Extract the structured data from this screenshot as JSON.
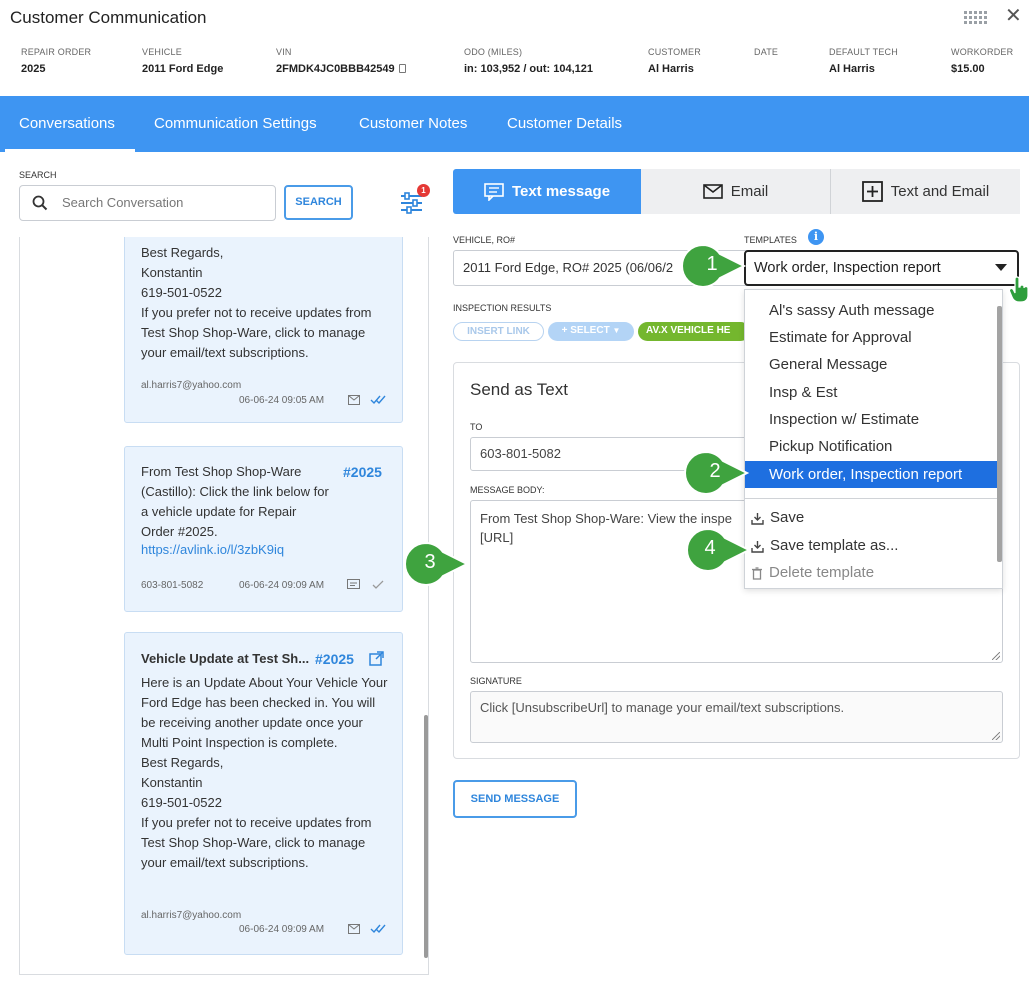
{
  "window": {
    "title": "Customer Communication",
    "close_glyph": "✕"
  },
  "info": [
    {
      "label": "REPAIR ORDER",
      "value": "2025"
    },
    {
      "label": "VEHICLE",
      "value": "2011 Ford Edge"
    },
    {
      "label": "VIN",
      "value": "2FMDK4JC0BBB42549"
    },
    {
      "label": "ODO (MILES)",
      "value": "in: 103,952 / out: 104,121"
    },
    {
      "label": "CUSTOMER",
      "value": "Al Harris"
    },
    {
      "label": "DATE",
      "value": ""
    },
    {
      "label": "DEFAULT TECH",
      "value": "Al Harris"
    },
    {
      "label": "WORKORDER",
      "value": "$15.00"
    }
  ],
  "nav": {
    "tabs": [
      {
        "label": "Conversations",
        "active": true
      },
      {
        "label": "Communication Settings"
      },
      {
        "label": "Customer Notes"
      },
      {
        "label": "Customer Details"
      }
    ],
    "accent": "#3e95f2"
  },
  "search": {
    "label": "SEARCH",
    "placeholder": "Search Conversation",
    "button": "SEARCH",
    "filter_badge": "1"
  },
  "conversations": [
    {
      "body": "Best Regards,\nKonstantin\n619-501-0522\nIf you prefer not to receive updates from Test Shop Shop-Ware, click to manage your email/text subscriptions.",
      "sender": "al.harris7@yahoo.com",
      "time": "06-06-24 09:05 AM"
    },
    {
      "body": "From Test Shop Shop-Ware (Castillo): Click the link below for a vehicle update for Repair Order #2025.",
      "link": "https://avlink.io/l/3zbK9iq",
      "ro": "#2025",
      "sender": "603-801-5082",
      "time": "06-06-24 09:09 AM"
    },
    {
      "heading": "Vehicle Update at Test Sh...",
      "ro": "#2025",
      "body": "Here is an Update About Your Vehicle Your Ford Edge has been checked in. You will be receiving another update once your Multi Point Inspection is complete.\nBest Regards,\nKonstantin\n619-501-0522\nIf you prefer not to receive updates from Test Shop Shop-Ware, click to manage your email/text subscriptions.",
      "sender": "al.harris7@yahoo.com",
      "time": "06-06-24 09:09 AM"
    }
  ],
  "channels": {
    "text": "Text message",
    "email": "Email",
    "both": "Text and Email"
  },
  "form": {
    "vehicle_label": "VEHICLE, RO#",
    "vehicle_value": "2011 Ford Edge, RO# 2025 (06/06/2",
    "templates_label": "TEMPLATES",
    "template_value": "Work order, Inspection report",
    "inspection_label": "INSPECTION RESULTS",
    "pills": {
      "insert_link": "INSERT LINK",
      "select": "+ SELECT",
      "avx": "AV.X VEHICLE HE"
    },
    "send_title": "Send as Text",
    "to_label": "TO",
    "to_value": "603-801-5082",
    "body_label": "MESSAGE BODY:",
    "body_value": "From Test Shop Shop-Ware: View the inspe\n[URL]",
    "signature_label": "SIGNATURE",
    "signature_value": "Click [UnsubscribeUrl] to manage your email/text subscriptions.",
    "send_button": "SEND MESSAGE"
  },
  "dropdown": {
    "items": [
      "Al's sassy Auth message",
      "Estimate for Approval",
      "General Message",
      "Insp & Est",
      "Inspection w/ Estimate",
      "Pickup Notification",
      "Work order, Inspection report"
    ],
    "selected_index": 6,
    "actions": {
      "save": "Save",
      "save_as": "Save template as...",
      "delete": "Delete template"
    },
    "selected_color": "#1e6fe0"
  },
  "callouts": [
    "1",
    "2",
    "3",
    "4"
  ],
  "callout_color": "#3fa33f"
}
